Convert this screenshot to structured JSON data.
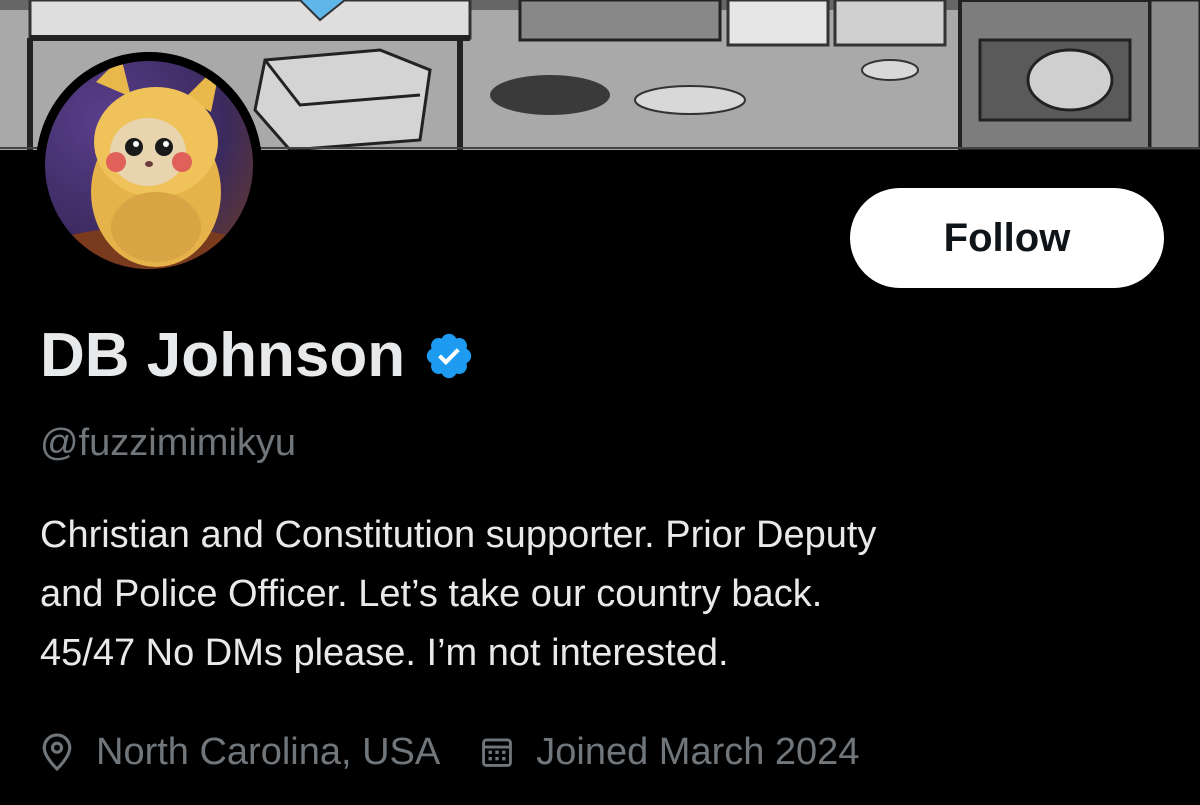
{
  "profile": {
    "display_name": "DB Johnson",
    "verified": true,
    "handle": "@fuzzimimikyu",
    "bio_lines": [
      "Christian and Constitution supporter. Prior Deputy",
      "and Police Officer. Let’s take our country back.",
      "45/47 No DMs please. I’m not interested."
    ],
    "location": "North Carolina, USA",
    "joined": "Joined March 2024"
  },
  "actions": {
    "follow_label": "Follow"
  },
  "icons": {
    "verified": "verified-badge-icon",
    "location": "location-pin-icon",
    "calendar": "calendar-icon"
  },
  "colors": {
    "background": "#000000",
    "verified_blue": "#1d9bf0",
    "primary_text": "#e7e9ea",
    "secondary_text": "#71767b",
    "button_bg": "#ffffff"
  }
}
